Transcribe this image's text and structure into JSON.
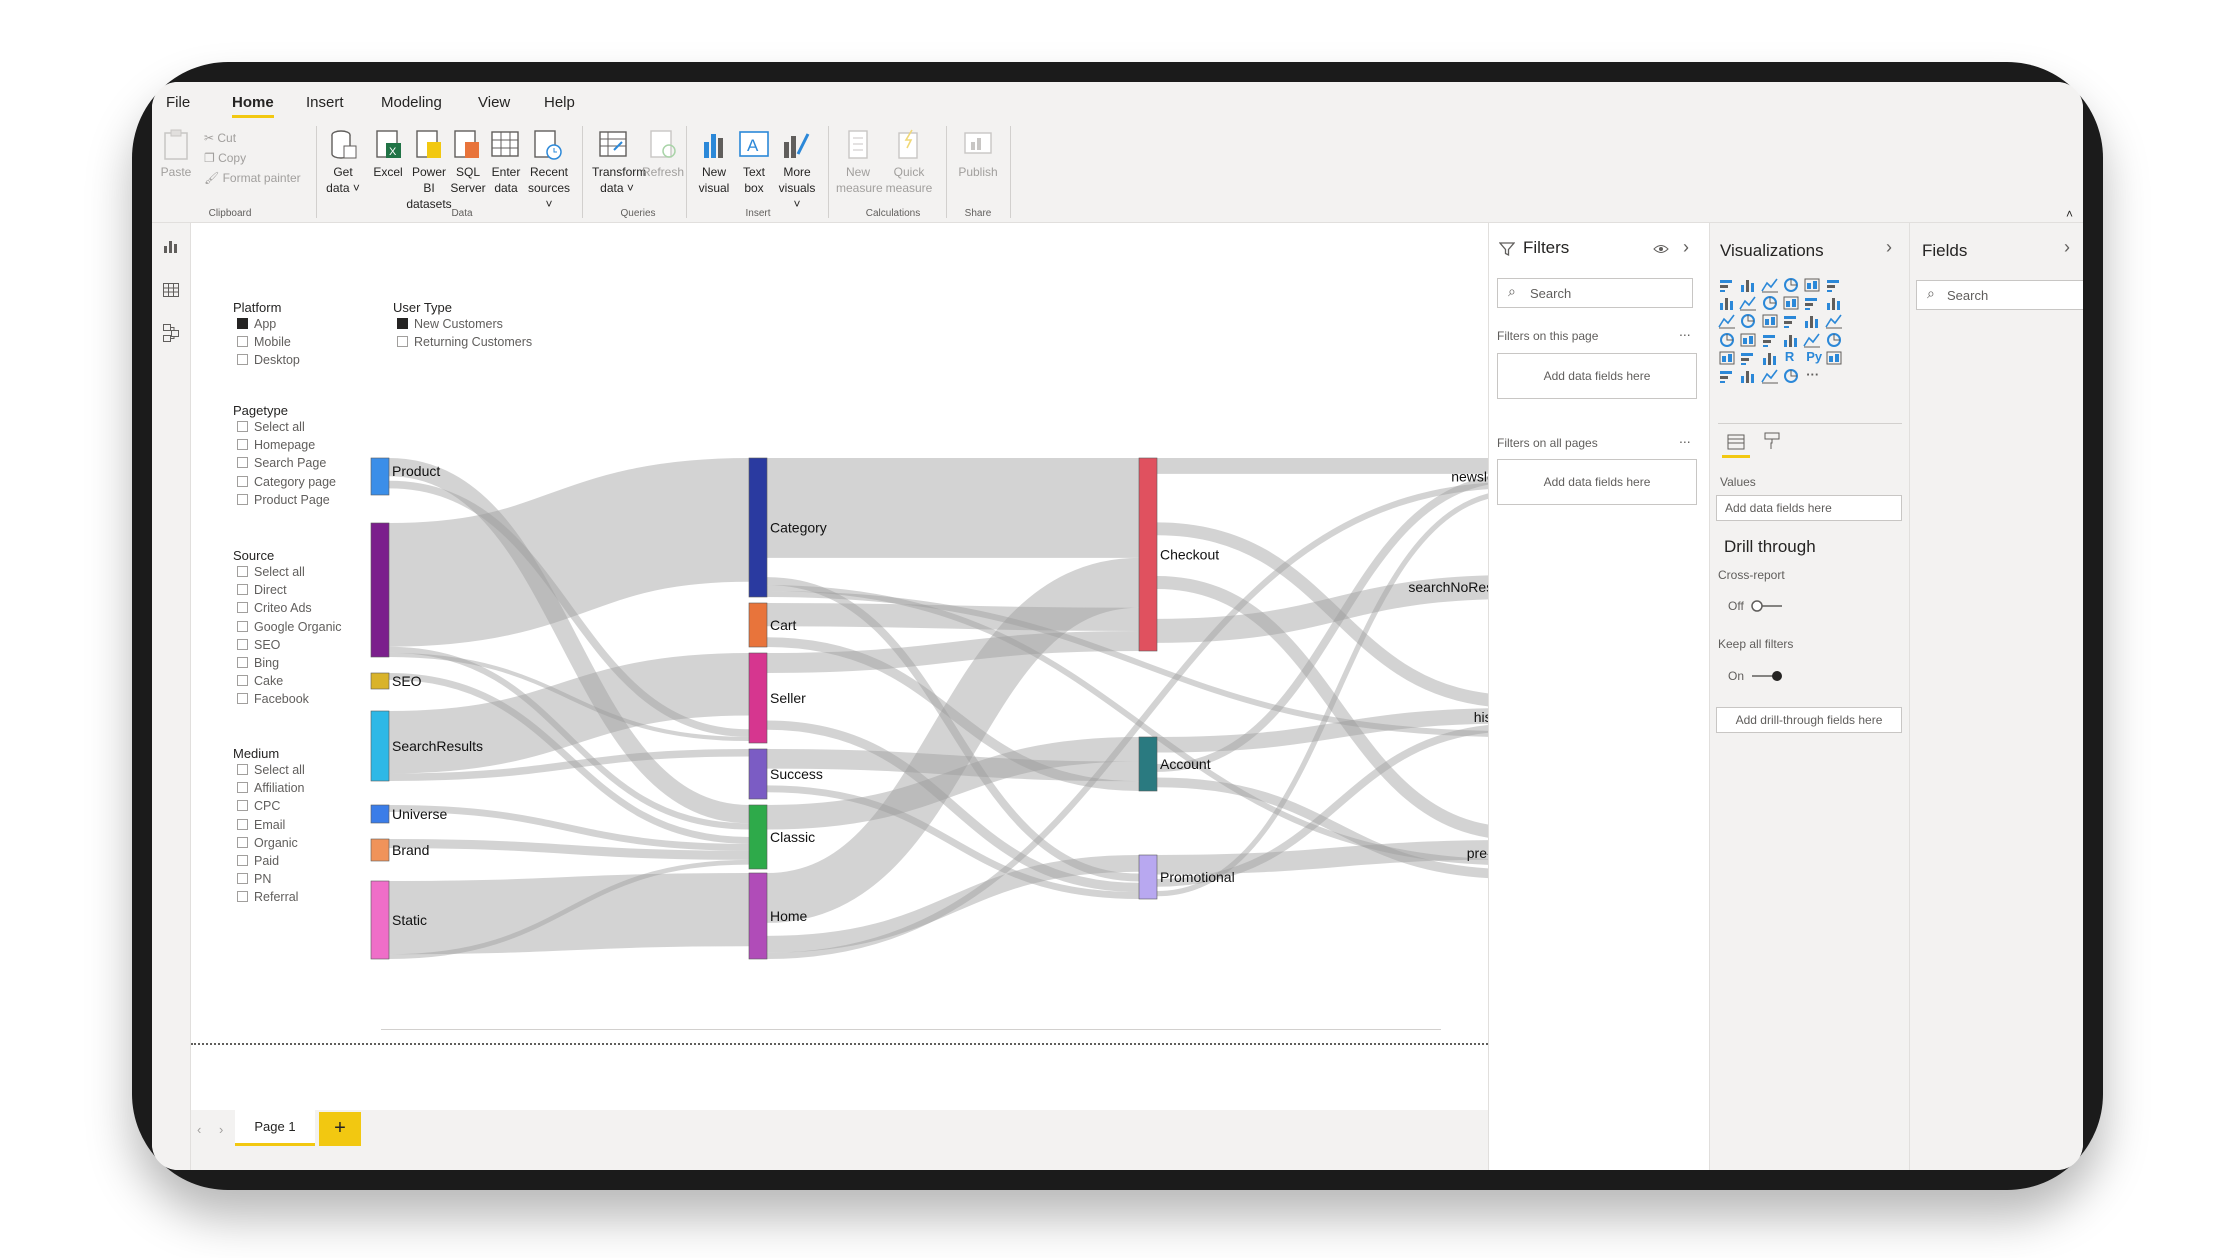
{
  "menu": [
    "File",
    "Home",
    "Insert",
    "Modeling",
    "View",
    "Help"
  ],
  "ribbon": {
    "clipboard": {
      "paste": "Paste",
      "cut": "Cut",
      "copy": "Copy",
      "format_painter": "Format painter",
      "group": "Clipboard"
    },
    "data": {
      "get_data": [
        "Get",
        "data"
      ],
      "excel": "Excel",
      "powerbi": [
        "Power BI",
        "datasets"
      ],
      "sql": [
        "SQL",
        "Server"
      ],
      "enter": [
        "Enter",
        "data"
      ],
      "recent": [
        "Recent",
        "sources"
      ],
      "group": "Data"
    },
    "queries": {
      "transform": [
        "Transform",
        "data"
      ],
      "refresh": "Refresh",
      "group": "Queries"
    },
    "insert": {
      "new_visual": [
        "New",
        "visual"
      ],
      "text_box": [
        "Text",
        "box"
      ],
      "more_visuals": [
        "More",
        "visuals"
      ],
      "group": "Insert"
    },
    "calculations": {
      "new_measure": [
        "New",
        "measure"
      ],
      "quick_measure": [
        "Quick",
        "measure"
      ],
      "group": "Calculations"
    },
    "share": {
      "publish": "Publish",
      "group": "Share"
    }
  },
  "slicers": {
    "platform": {
      "title": "Platform",
      "items": [
        "App",
        "Mobile",
        "Desktop"
      ],
      "checked": [
        true,
        false,
        false
      ]
    },
    "user_type": {
      "title": "User Type",
      "items": [
        "New Customers",
        "Returning Customers"
      ],
      "checked": [
        true,
        false
      ]
    },
    "pagetype": {
      "title": "Pagetype",
      "items": [
        "Select all",
        "Homepage",
        "Search Page",
        "Category page",
        "Product Page"
      ]
    },
    "source": {
      "title": "Source",
      "items": [
        "Select all",
        "Direct",
        "Criteo Ads",
        "Google Organic",
        "SEO",
        "Bing",
        "Cake",
        "Facebook"
      ]
    },
    "medium": {
      "title": "Medium",
      "items": [
        "Select all",
        "Affiliation",
        "CPC",
        "Email",
        "Organic",
        "Paid",
        "PN",
        "Referral"
      ]
    }
  },
  "sankey": {
    "nodes": [
      {
        "id": "product",
        "label": "Product",
        "col": 0,
        "color": "#3b8ee8"
      },
      {
        "id": "purple",
        "label": "",
        "col": 0,
        "color": "#7b1f8c"
      },
      {
        "id": "seo",
        "label": "SEO",
        "col": 0,
        "color": "#d9b32a"
      },
      {
        "id": "searchresults",
        "label": "SearchResults",
        "col": 0,
        "color": "#2eb8e6"
      },
      {
        "id": "universe",
        "label": "Universe",
        "col": 0,
        "color": "#3b7de8"
      },
      {
        "id": "brand",
        "label": "Brand",
        "col": 0,
        "color": "#f0935a"
      },
      {
        "id": "static",
        "label": "Static",
        "col": 0,
        "color": "#ef6ec8"
      },
      {
        "id": "category",
        "label": "Category",
        "col": 1,
        "color": "#2a3aa0"
      },
      {
        "id": "cart",
        "label": "Cart",
        "col": 1,
        "color": "#e8743b"
      },
      {
        "id": "seller",
        "label": "Seller",
        "col": 1,
        "color": "#d6368f"
      },
      {
        "id": "success",
        "label": "Success",
        "col": 1,
        "color": "#7b5cc4"
      },
      {
        "id": "classic",
        "label": "Classic",
        "col": 1,
        "color": "#2eaa4a"
      },
      {
        "id": "home",
        "label": "Home",
        "col": 1,
        "color": "#b04cb8"
      },
      {
        "id": "checkout",
        "label": "Checkout",
        "col": 2,
        "color": "#e0515f"
      },
      {
        "id": "account",
        "label": "Account",
        "col": 2,
        "color": "#2a7a80"
      },
      {
        "id": "promotional",
        "label": "Promotional",
        "col": 2,
        "color": "#b8a8f0"
      },
      {
        "id": "newsletter",
        "label": "newsletter",
        "col": 3,
        "color": "#c9a82a"
      },
      {
        "id": "searchnoresults",
        "label": "searchNoResults",
        "col": 3,
        "color": "#f07880"
      },
      {
        "id": "history",
        "label": "history",
        "col": 3,
        "color": "#2ad6c0"
      },
      {
        "id": "precart",
        "label": "pre-cart",
        "col": 3,
        "color": "#5cd068"
      }
    ]
  },
  "pages": {
    "tab": "Page 1",
    "add": "+"
  },
  "filters": {
    "title": "Filters",
    "search": "Search",
    "on_this_page": "Filters on this page",
    "on_all_pages": "Filters on all pages",
    "add_fields": "Add data fields here",
    "more": "..."
  },
  "visualizations": {
    "title": "Visualizations",
    "values_label": "Values",
    "add_fields": "Add data fields here",
    "drill_through": "Drill through",
    "cross_report": "Cross-report",
    "off": "Off",
    "keep_all_filters": "Keep all filters",
    "on": "On",
    "add_drill": "Add drill-through fields here",
    "r_icon": "R",
    "py_icon": "Py",
    "more_icon": "···"
  },
  "fields": {
    "title": "Fields",
    "search": "Search"
  },
  "colors": {
    "accent": "#f2c811",
    "pbi_blue": "#2b88d8"
  }
}
